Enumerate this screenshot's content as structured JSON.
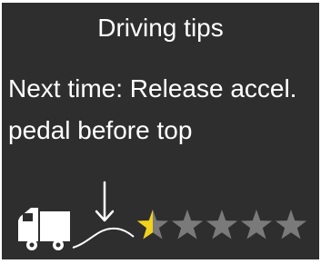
{
  "screen": {
    "title": "Driving tips",
    "message_line1": "Next time: Release accel.",
    "message_line2": "pedal before top"
  },
  "rating": {
    "value": 0.5,
    "max": 5,
    "filled_color": "#f2d21a",
    "empty_color": "#7a7a7a"
  },
  "icons": {
    "truck": "truck-icon",
    "release_point": "down-arrow-icon",
    "hill": "hill-road-icon"
  },
  "colors": {
    "background": "#2e2e2e",
    "text": "#ffffff"
  }
}
